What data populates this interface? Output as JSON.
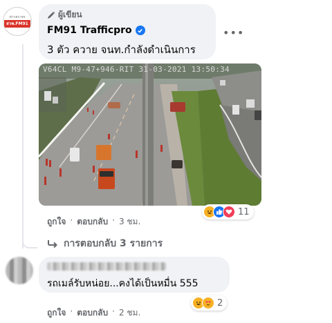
{
  "comment": {
    "avatar": {
      "top_text": "ข่าวจราจร",
      "mid_text": "สวพ.FM91"
    },
    "author_badge": "ผู้เขียน",
    "author_name": "FM91 Trafficpro",
    "text": "3 ตัว ควาย จนท.กำลังดำเนินการ",
    "more_icon": "more-horizontal-icon",
    "camera_stamp": "V64CL M9-47+946-RIT  31-03-2021 13:50:34",
    "reactions": {
      "icons": [
        "haha-icon",
        "like-icon",
        "love-icon"
      ],
      "count": "11"
    },
    "actions": {
      "like": "ถูกใจ",
      "reply": "ตอบกลับ",
      "time": "3 ชม."
    },
    "replies_label": "การตอบกลับ 3 รายการ"
  },
  "reply": {
    "text": "รถเมล์รับหน่อย...คงได้เป็นหมื่น 555",
    "reactions": {
      "icons": [
        "haha-icon",
        "love-face-icon"
      ],
      "count": "2"
    },
    "actions": {
      "like": "ถูกใจ",
      "reply": "ตอบกลับ",
      "time": "2 ชม."
    }
  },
  "colors": {
    "facebook_blue": "#1877f2",
    "bubble_bg": "#f0f2f5",
    "secondary_text": "#65676b",
    "love_red": "#f33e58",
    "haha_yellow": "#f7b125"
  }
}
